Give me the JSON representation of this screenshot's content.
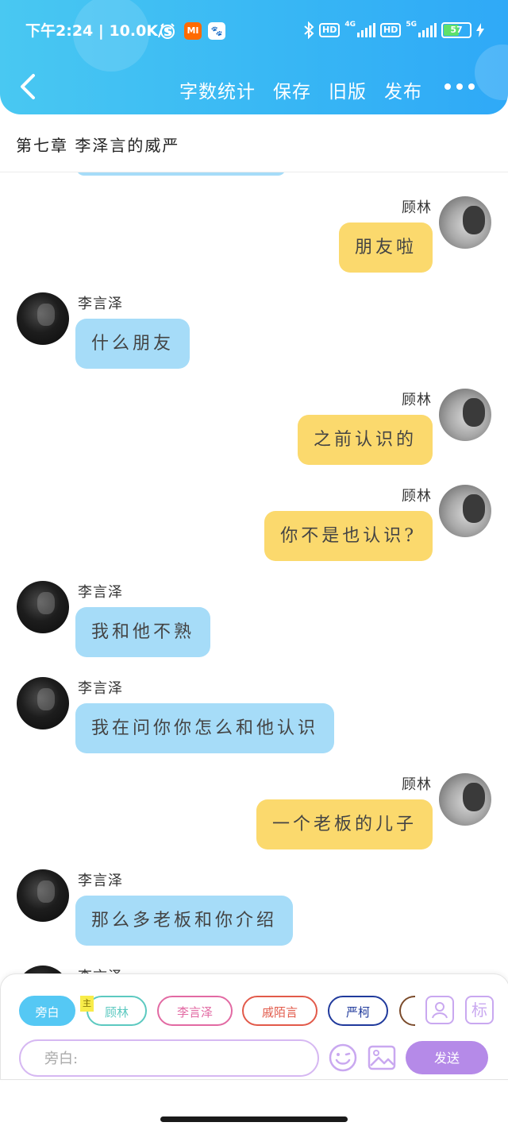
{
  "status_bar": {
    "time": "下午2:24",
    "speed": "10.0K/s",
    "mi_icon_text": "MI",
    "hd1": "HD",
    "net1": "4G",
    "hd2": "HD",
    "net2": "5G",
    "battery": "57"
  },
  "header": {
    "actions": [
      "字数统计",
      "保存",
      "旧版",
      "发布"
    ],
    "back_icon": "chevron-left-icon",
    "more_icon": "more-horizontal-icon",
    "gradient_colors": [
      "#49c8f2",
      "#2fa9f7"
    ]
  },
  "chapter_title": "第七章 李泽言的威严",
  "messages": [
    {
      "side": "right",
      "name": "顾林",
      "text": "朋友啦"
    },
    {
      "side": "left",
      "name": "李言泽",
      "text": "什么朋友"
    },
    {
      "side": "right",
      "name": "顾林",
      "text": "之前认识的"
    },
    {
      "side": "right",
      "name": "顾林",
      "text": "你不是也认识?"
    },
    {
      "side": "left",
      "name": "李言泽",
      "text": "我和他不熟"
    },
    {
      "side": "left",
      "name": "李言泽",
      "text": "我在问你你怎么和他认识"
    },
    {
      "side": "right",
      "name": "顾林",
      "text": "一个老板的儿子"
    },
    {
      "side": "left",
      "name": "李言泽",
      "text": "那么多老板和你介绍"
    },
    {
      "side": "left",
      "name": "李言泽",
      "text": ""
    }
  ],
  "colors": {
    "left_bubble": "#a6dcf8",
    "right_bubble": "#fbd96d"
  },
  "characters": [
    {
      "label": "旁白",
      "active": true,
      "color": "#55c8f4"
    },
    {
      "label": "顾林",
      "color": "#5cc9c0",
      "badge": "主"
    },
    {
      "label": "李言泽",
      "color": "#e26aa3"
    },
    {
      "label": "戚陌言",
      "color": "#e25a4a"
    },
    {
      "label": "严柯",
      "color": "#203a9c"
    }
  ],
  "tools": {
    "contact_icon": "contact-card-icon",
    "tag_label": "标"
  },
  "composer": {
    "placeholder": "旁白:",
    "emoji_icon": "smiley-icon",
    "image_icon": "image-icon",
    "send_label": "发送"
  }
}
